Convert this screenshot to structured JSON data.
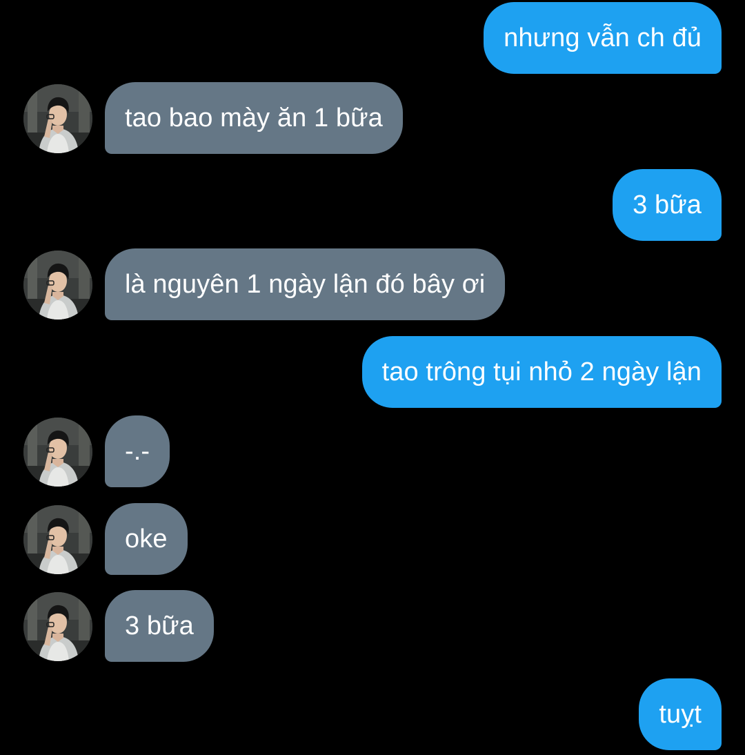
{
  "conversation": {
    "messages": [
      {
        "sender": "me",
        "text": "nhưng vẫn ch đủ"
      },
      {
        "sender": "friend",
        "text": "tao bao mày ăn 1 bữa"
      },
      {
        "sender": "me",
        "text": "3 bữa"
      },
      {
        "sender": "friend",
        "text": "là nguyên 1 ngày lận đó bây ơi"
      },
      {
        "sender": "me",
        "text": "tao trông tụi nhỏ 2 ngày lận"
      },
      {
        "sender": "friend",
        "text": "-.-"
      },
      {
        "sender": "friend",
        "text": "oke"
      },
      {
        "sender": "friend",
        "text": "3 bữa"
      },
      {
        "sender": "me",
        "text": "tuỵt"
      }
    ]
  },
  "colors": {
    "background": "#000000",
    "outgoing_bubble": "#1ea1f1",
    "incoming_bubble": "#657786",
    "text": "#ffffff"
  },
  "icons": {
    "friend_avatar": "profile-photo-avatar"
  }
}
